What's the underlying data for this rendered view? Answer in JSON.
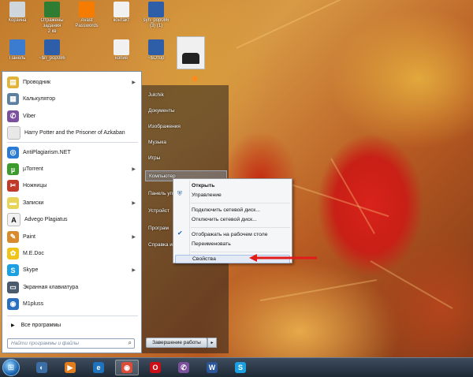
{
  "desktop": {
    "icons": [
      {
        "label": "Корзина",
        "color": "#cfd6dc"
      },
      {
        "label": "Отражены\nзадания\n2 кв",
        "color": "#2e7d32"
      },
      {
        "label": "Avast\nPasswords",
        "color": "#f57c00"
      },
      {
        "label": "контакт",
        "color": "#f1f1f1"
      },
      {
        "label": "syn_pop086\n(3) (1)",
        "color": "#2f5ea8"
      },
      {
        "label": "Панель",
        "color": "#3b7bd0"
      },
      {
        "label": "~$n_pop086",
        "color": "#2f5ea8"
      },
      {
        "label": "копия",
        "color": "#f1f1f1"
      },
      {
        "label": "~$Отор",
        "color": "#2f5ea8"
      }
    ]
  },
  "start_menu": {
    "programs": [
      {
        "label": "Проводник",
        "icon": "explorer-icon",
        "color": "#e2b33a",
        "glyph": "▤",
        "arrow": true
      },
      {
        "label": "Калькулятор",
        "icon": "calculator-icon",
        "color": "#5f7f9f",
        "glyph": "▦",
        "arrow": false
      },
      {
        "label": "Viber",
        "icon": "viber-icon",
        "color": "#7b519d",
        "glyph": "✆",
        "arrow": false
      },
      {
        "label": "Harry Potter and the Prisoner of Azkaban",
        "icon": "game-icon",
        "color": "#e8e8e8",
        "glyph": "",
        "arrow": false
      },
      {
        "label": "AntiPlagiarism.NET",
        "icon": "antiplagiarism-icon",
        "color": "#2a7bd4",
        "glyph": "◎",
        "arrow": false
      },
      {
        "label": "µTorrent",
        "icon": "utorrent-icon",
        "color": "#3c9a2e",
        "glyph": "µ",
        "arrow": true
      },
      {
        "label": "Ножницы",
        "icon": "scissors-icon",
        "color": "#c0392b",
        "glyph": "✂",
        "arrow": false
      },
      {
        "label": "Записки",
        "icon": "notes-icon",
        "color": "#e9d45a",
        "glyph": "▬",
        "arrow": true
      },
      {
        "label": "Advego Plagiatus",
        "icon": "advego-icon",
        "color": "#f2f2f2",
        "glyph": "A",
        "arrow": false
      },
      {
        "label": "Paint",
        "icon": "paint-icon",
        "color": "#d88b2d",
        "glyph": "✎",
        "arrow": true
      },
      {
        "label": "M.E.Doc",
        "icon": "medoc-icon",
        "color": "#f0c419",
        "glyph": "✿",
        "arrow": false
      },
      {
        "label": "Skype",
        "icon": "skype-icon",
        "color": "#1ba1e2",
        "glyph": "S",
        "arrow": true
      },
      {
        "label": "Экранная клавиатура",
        "icon": "keyboard-icon",
        "color": "#4a5b6e",
        "glyph": "▭",
        "arrow": false
      },
      {
        "label": "M1pluss",
        "icon": "m1pluss-icon",
        "color": "#2a6fc0",
        "glyph": "◉",
        "arrow": false
      }
    ],
    "all_programs": "Все программы",
    "search_placeholder": "Найти программы и файлы",
    "right": [
      {
        "label": "Julchik",
        "highlight": false
      },
      {
        "label": "Документы",
        "highlight": false
      },
      {
        "label": "Изображения",
        "highlight": false
      },
      {
        "label": "Музыка",
        "highlight": false
      },
      {
        "label": "Игры",
        "highlight": false
      },
      {
        "label": "Компьютер",
        "highlight": true
      },
      {
        "label": "Панель упр",
        "highlight": false
      },
      {
        "label": "Устройст",
        "highlight": false
      },
      {
        "label": "Програм",
        "highlight": false
      },
      {
        "label": "Справка и",
        "highlight": false
      }
    ],
    "shutdown": "Завершение работы"
  },
  "context_menu": {
    "items": [
      {
        "label": "Открыть",
        "bold": true,
        "icon": ""
      },
      {
        "label": "Управление",
        "bold": false,
        "icon": "shield-icon"
      },
      {
        "sep": true
      },
      {
        "label": "Подключить сетевой диск...",
        "bold": false,
        "icon": ""
      },
      {
        "label": "Отключить сетевой диск...",
        "bold": false,
        "icon": ""
      },
      {
        "sep": true
      },
      {
        "label": "Отображать на рабочем столе",
        "bold": false,
        "icon": "check-icon"
      },
      {
        "label": "Переименовать",
        "bold": false,
        "icon": ""
      },
      {
        "sep": true
      },
      {
        "label": "Свойства",
        "bold": false,
        "icon": "",
        "highlight": true
      }
    ]
  },
  "taskbar": {
    "items": [
      {
        "icon": "explorer-icon",
        "color": "#3a6ea5",
        "glyph": "◐",
        "active": false
      },
      {
        "icon": "media-player-icon",
        "color": "#e27d1e",
        "glyph": "▶",
        "active": false
      },
      {
        "icon": "internet-explorer-icon",
        "color": "#1e73be",
        "glyph": "e",
        "active": false
      },
      {
        "icon": "chrome-icon",
        "color": "#dd4b39",
        "glyph": "◉",
        "active": true
      },
      {
        "icon": "opera-icon",
        "color": "#cc0f16",
        "glyph": "O",
        "active": false
      },
      {
        "icon": "viber-icon",
        "color": "#7b519d",
        "glyph": "✆",
        "active": false
      },
      {
        "icon": "word-icon",
        "color": "#2b579a",
        "glyph": "W",
        "active": false
      },
      {
        "icon": "skype-icon",
        "color": "#1ba1e2",
        "glyph": "S",
        "active": false
      }
    ]
  }
}
